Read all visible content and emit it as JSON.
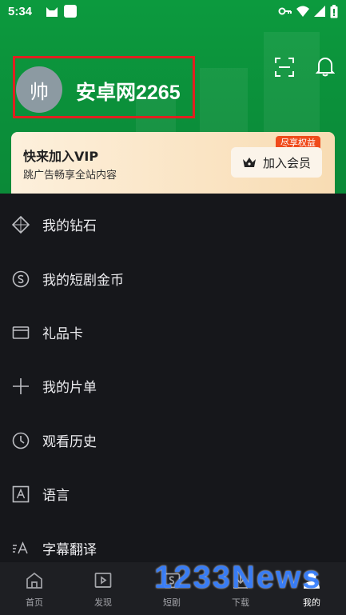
{
  "status_bar": {
    "time": "5:34",
    "icons": [
      "cat-icon",
      "square-icon",
      "key-icon",
      "wifi-icon",
      "signal-icon",
      "battery-icon"
    ]
  },
  "profile": {
    "avatar_text": "帅",
    "username": "安卓网2265",
    "highlight_color": "#e02020"
  },
  "header_actions": {
    "scan_icon": "scan-icon",
    "bell_icon": "bell-icon"
  },
  "vip": {
    "title": "快来加入VIP",
    "subtitle": "跳广告畅享全站内容",
    "tag": "尽享权益",
    "button_label": "加入会员",
    "tag_color": "#f04a1a"
  },
  "menu": {
    "items": [
      {
        "label": "我的钻石",
        "icon": "diamond-icon"
      },
      {
        "label": "我的短剧金币",
        "icon": "coin-icon"
      },
      {
        "label": "礼品卡",
        "icon": "card-icon"
      },
      {
        "label": "我的片单",
        "icon": "plus-icon"
      },
      {
        "label": "观看历史",
        "icon": "history-icon"
      },
      {
        "label": "语言",
        "icon": "language-icon"
      },
      {
        "label": "字幕翻译",
        "icon": "subtitle-icon"
      }
    ]
  },
  "bottom_nav": {
    "items": [
      {
        "label": "首页",
        "icon": "home-icon"
      },
      {
        "label": "发现",
        "icon": "discover-icon"
      },
      {
        "label": "短剧",
        "icon": "shortdrama-icon"
      },
      {
        "label": "下载",
        "icon": "download-icon"
      },
      {
        "label": "我的",
        "icon": "profile-icon",
        "active": true
      }
    ]
  },
  "watermark": "1233News",
  "colors": {
    "header_green": "#0b8f3a",
    "background": "#16171b",
    "nav_background": "#1e1f23",
    "watermark_blue": "#3b82ff"
  }
}
